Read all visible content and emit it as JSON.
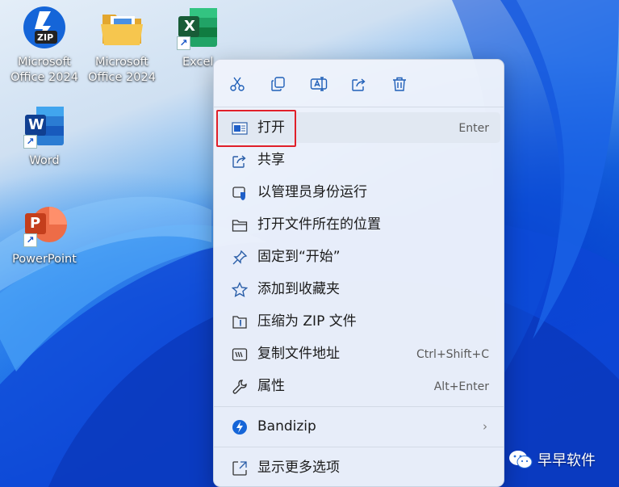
{
  "desktop": {
    "icons": [
      {
        "label_line1": "Microsoft",
        "label_line2": "Office 2024",
        "badge": "ZIP",
        "icon": "zip-archive-icon"
      },
      {
        "label_line1": "Microsoft",
        "label_line2": "Office 2024",
        "icon": "folder-icon"
      },
      {
        "label_line1": "Excel",
        "letter": "X",
        "icon": "excel-icon"
      },
      {
        "label_line1": "Word",
        "letter": "W",
        "icon": "word-icon"
      },
      {
        "label_line1": "PowerPoint",
        "letter": "P",
        "icon": "powerpoint-icon"
      }
    ],
    "shortcut_glyph": "↗"
  },
  "context_menu": {
    "quick_actions": [
      {
        "icon": "cut-icon"
      },
      {
        "icon": "copy-icon"
      },
      {
        "icon": "rename-icon"
      },
      {
        "icon": "share-icon"
      },
      {
        "icon": "delete-icon"
      }
    ],
    "items": [
      {
        "label": "打开",
        "shortcut": "Enter",
        "icon": "open-icon"
      },
      {
        "label": "共享",
        "shortcut": "",
        "icon": "share-icon"
      },
      {
        "label": "以管理员身份运行",
        "shortcut": "",
        "icon": "admin-shield-icon"
      },
      {
        "label": "打开文件所在的位置",
        "shortcut": "",
        "icon": "folder-icon"
      },
      {
        "label": "固定到“开始”",
        "shortcut": "",
        "icon": "pin-icon"
      },
      {
        "label": "添加到收藏夹",
        "shortcut": "",
        "icon": "star-icon"
      },
      {
        "label": "压缩为 ZIP 文件",
        "shortcut": "",
        "icon": "zip-icon"
      },
      {
        "label": "复制文件地址",
        "shortcut": "Ctrl+Shift+C",
        "icon": "copy-path-icon"
      },
      {
        "label": "属性",
        "shortcut": "Alt+Enter",
        "icon": "wrench-icon"
      }
    ],
    "bandizip": {
      "label": "Bandizip",
      "arrow": "›",
      "icon": "bandizip-icon"
    },
    "more": {
      "label": "显示更多选项",
      "icon": "more-options-icon"
    }
  },
  "watermark": {
    "text": "早早软件",
    "icon": "wechat-icon"
  },
  "colors": {
    "accent": "#0a5bd6",
    "highlight_box": "#e0202a",
    "excel": "#1d7a43",
    "word": "#2b5fbf",
    "powerpoint": "#d24726"
  }
}
